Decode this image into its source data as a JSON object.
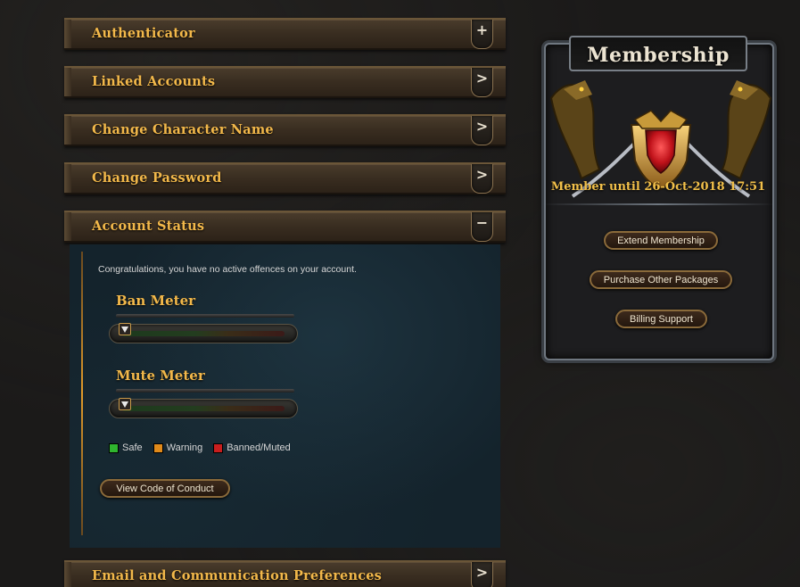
{
  "sections": {
    "authenticator": {
      "label": "Authenticator",
      "icon": "+"
    },
    "linked_accounts": {
      "label": "Linked Accounts",
      "icon": ">"
    },
    "change_character_name": {
      "label": "Change Character Name",
      "icon": ">"
    },
    "change_password": {
      "label": "Change Password",
      "icon": ">"
    },
    "account_status": {
      "label": "Account Status",
      "icon": "−"
    },
    "email_preferences": {
      "label": "Email and Communication Preferences",
      "icon": ">"
    }
  },
  "account_status": {
    "message": "Congratulations, you have no active offences on your account.",
    "ban_meter": {
      "label": "Ban Meter",
      "level": 0
    },
    "mute_meter": {
      "label": "Mute Meter",
      "level": 0
    },
    "legend": {
      "safe": {
        "label": "Safe",
        "color": "#2fb52f"
      },
      "warning": {
        "label": "Warning",
        "color": "#e08a1a"
      },
      "banned": {
        "label": "Banned/Muted",
        "color": "#c81e1e"
      }
    },
    "code_of_conduct_button": "View Code of Conduct"
  },
  "membership": {
    "title": "Membership",
    "until": "Member until 26-Oct-2018 17:51",
    "buttons": {
      "extend": "Extend Membership",
      "purchase": "Purchase Other Packages",
      "billing": "Billing Support"
    }
  },
  "colors": {
    "accent_gold": "#f2b84a",
    "panel_blue": "#14232c"
  }
}
